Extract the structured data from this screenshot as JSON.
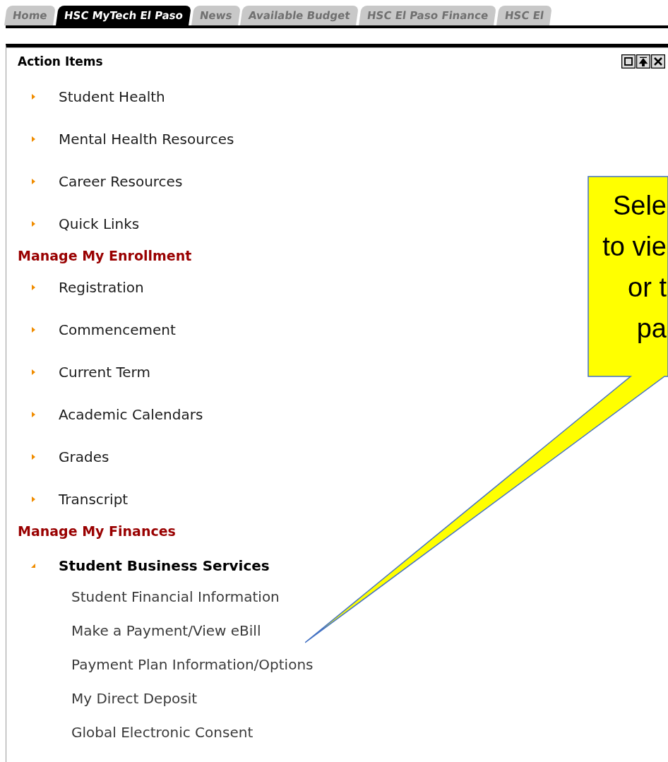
{
  "tabs": [
    {
      "label": "Home",
      "selected": false
    },
    {
      "label": "HSC MyTech El Paso",
      "selected": true
    },
    {
      "label": "News",
      "selected": false
    },
    {
      "label": "Available Budget",
      "selected": false
    },
    {
      "label": "HSC El Paso Finance",
      "selected": false
    },
    {
      "label": "HSC El",
      "selected": false
    }
  ],
  "portlet": {
    "title": "Action Items"
  },
  "sections": [
    {
      "items": [
        {
          "label": "Student Health",
          "expanded": false
        },
        {
          "label": "Mental Health Resources",
          "expanded": false
        },
        {
          "label": "Career Resources",
          "expanded": false
        },
        {
          "label": "Quick Links",
          "expanded": false
        }
      ]
    },
    {
      "heading": "Manage My Enrollment",
      "items": [
        {
          "label": "Registration",
          "expanded": false
        },
        {
          "label": "Commencement",
          "expanded": false
        },
        {
          "label": "Current Term",
          "expanded": false
        },
        {
          "label": "Academic Calendars",
          "expanded": false
        },
        {
          "label": "Grades",
          "expanded": false
        },
        {
          "label": "Transcript",
          "expanded": false
        }
      ]
    },
    {
      "heading": "Manage My Finances",
      "items": [
        {
          "label": "Student Business Services",
          "expanded": true,
          "children": [
            {
              "label": "Student Financial Information"
            },
            {
              "label": "Make a Payment/View eBill"
            },
            {
              "label": "Payment Plan Information/Options"
            },
            {
              "label": "My Direct Deposit"
            },
            {
              "label": "Global Electronic Consent"
            }
          ]
        }
      ]
    }
  ],
  "callout": {
    "lines": [
      "Sele",
      "to vie",
      "or t",
      "pa"
    ]
  }
}
